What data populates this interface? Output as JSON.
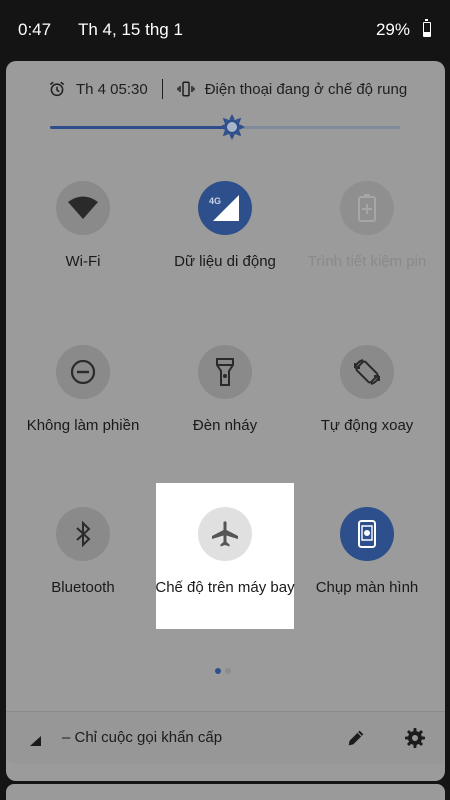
{
  "status_bar": {
    "time": "0:47",
    "date": "Th 4, 15 thg 1",
    "battery": "29%"
  },
  "header": {
    "alarm": "Th 4 05:30",
    "ringer_mode": "Điện thoại đang ở chế độ rung"
  },
  "brightness": {
    "level": 0.52
  },
  "tiles": [
    {
      "id": "wifi",
      "label": "Wi-Fi",
      "icon": "wifi-icon",
      "state": "off"
    },
    {
      "id": "mobile-data",
      "label": "Dữ liệu di động",
      "icon": "mobile-data-icon",
      "badge": "4G",
      "state": "on"
    },
    {
      "id": "battery-saver",
      "label": "Trình tiết kiệm pin",
      "icon": "battery-saver-icon",
      "state": "unavailable"
    },
    {
      "id": "dnd",
      "label": "Không làm phiền",
      "icon": "do-not-disturb-icon",
      "state": "off"
    },
    {
      "id": "flashlight",
      "label": "Đèn nháy",
      "icon": "flashlight-icon",
      "state": "off"
    },
    {
      "id": "auto-rotate",
      "label": "Tự động xoay",
      "icon": "auto-rotate-icon",
      "state": "off"
    },
    {
      "id": "bluetooth",
      "label": "Bluetooth",
      "icon": "bluetooth-icon",
      "state": "off"
    },
    {
      "id": "airplane",
      "label": "Chế độ trên máy bay",
      "icon": "airplane-icon",
      "state": "off",
      "highlighted": true
    },
    {
      "id": "screenshot",
      "label": "Chụp màn hình",
      "icon": "screenshot-icon",
      "state": "on"
    }
  ],
  "pager": {
    "pages": 2,
    "current": 1
  },
  "footer": {
    "carrier_text": "– Chỉ cuộc gọi khẩn cấp",
    "edit_icon": "pencil-icon",
    "settings_icon": "gear-icon"
  },
  "colors": {
    "accent": "#2d4f8b",
    "panel": "#9b9b9b",
    "highlight": "#ffffff"
  }
}
